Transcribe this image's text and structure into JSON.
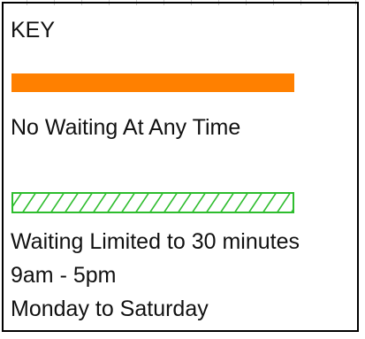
{
  "key": {
    "title": "KEY",
    "items": [
      {
        "swatch": "solid-orange-bar",
        "color": "#ff8000",
        "label": "No Waiting At Any Time"
      },
      {
        "swatch": "green-hatched-bar",
        "color": "#2ebd2e",
        "label_lines": [
          "Waiting Limited to 30 minutes",
          "9am - 5pm",
          "Monday to Saturday"
        ]
      }
    ]
  }
}
